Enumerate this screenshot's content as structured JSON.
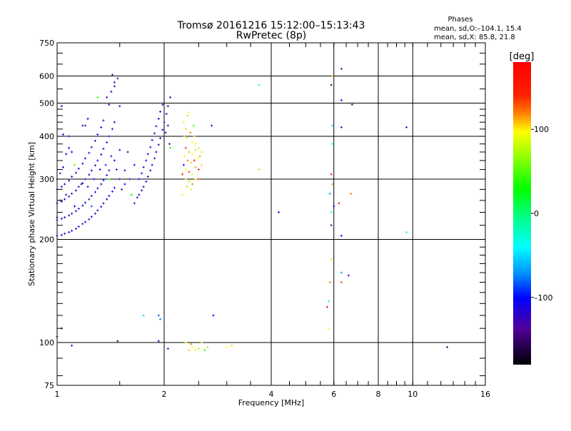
{
  "chart_data": {
    "type": "scatter",
    "title": "Tromsø 20161216 15:12:00–15:13:43",
    "subtitle": "RwPretec (8p)",
    "stats": {
      "title": "Phases",
      "line_o": "mean, sd,O:–104.1, 15.4",
      "line_x": "mean, sd,X:  85.8, 21.8"
    },
    "xlabel": "Frequency [MHz]",
    "ylabel": "Stationary phase Virtual Height [km]",
    "xscale": "log",
    "yscale": "log",
    "xlim": [
      1,
      16
    ],
    "ylim": [
      75,
      750
    ],
    "xticks": [
      1,
      2,
      4,
      6,
      8,
      10,
      16
    ],
    "xtick_labels": [
      "1",
      "2",
      "4",
      "6",
      "8",
      "10",
      "16"
    ],
    "xgrid": [
      2,
      4,
      6,
      8,
      10
    ],
    "yticks": [
      75,
      100,
      200,
      300,
      400,
      500,
      600,
      750
    ],
    "ytick_labels": [
      "75",
      "100",
      "200",
      "300",
      "400",
      "500",
      "600",
      "750"
    ],
    "ygrid": [
      100,
      200,
      300,
      400,
      500,
      600
    ],
    "colorbar": {
      "label": "[deg]",
      "range": [
        -180,
        180
      ],
      "ticks": [
        100,
        0,
        -100
      ],
      "tick_labels": [
        "100",
        "0",
        "–100"
      ]
    },
    "point_format": [
      "frequency_MHz",
      "height_km",
      "phase_deg"
    ],
    "points": [
      [
        1.0,
        205,
        -120
      ],
      [
        1.03,
        206,
        -110
      ],
      [
        1.05,
        208,
        -125
      ],
      [
        1.08,
        210,
        -115
      ],
      [
        1.1,
        212,
        -120
      ],
      [
        1.13,
        215,
        -110
      ],
      [
        1.15,
        218,
        -125
      ],
      [
        1.18,
        222,
        -120
      ],
      [
        1.2,
        225,
        -115
      ],
      [
        1.23,
        229,
        -125
      ],
      [
        1.25,
        233,
        -120
      ],
      [
        1.28,
        238,
        -110
      ],
      [
        1.3,
        243,
        -125
      ],
      [
        1.33,
        249,
        -120
      ],
      [
        1.35,
        255,
        -115
      ],
      [
        1.38,
        262,
        -125
      ],
      [
        1.4,
        268,
        -120
      ],
      [
        1.43,
        276,
        -110
      ],
      [
        1.45,
        283,
        -125
      ],
      [
        1.5,
        300,
        -120
      ],
      [
        1.55,
        318,
        -115
      ],
      [
        1.0,
        228,
        -115
      ],
      [
        1.03,
        230,
        -120
      ],
      [
        1.05,
        232,
        -110
      ],
      [
        1.08,
        235,
        -125
      ],
      [
        1.1,
        238,
        -120
      ],
      [
        1.13,
        242,
        -115
      ],
      [
        1.15,
        246,
        -125
      ],
      [
        1.18,
        251,
        -120
      ],
      [
        1.2,
        256,
        -110
      ],
      [
        1.23,
        262,
        -125
      ],
      [
        1.25,
        268,
        -120
      ],
      [
        1.28,
        275,
        -115
      ],
      [
        1.3,
        282,
        -125
      ],
      [
        1.33,
        290,
        -120
      ],
      [
        1.35,
        298,
        -110
      ],
      [
        1.38,
        308,
        -125
      ],
      [
        1.4,
        318,
        -120
      ],
      [
        1.45,
        340,
        -115
      ],
      [
        1.5,
        365,
        -120
      ],
      [
        1.0,
        255,
        -110
      ],
      [
        1.03,
        258,
        -120
      ],
      [
        1.05,
        262,
        -115
      ],
      [
        1.08,
        267,
        -125
      ],
      [
        1.1,
        272,
        -120
      ],
      [
        1.13,
        278,
        -110
      ],
      [
        1.15,
        285,
        -120
      ],
      [
        1.18,
        292,
        -125
      ],
      [
        1.2,
        300,
        -115
      ],
      [
        1.23,
        309,
        -120
      ],
      [
        1.25,
        318,
        -110
      ],
      [
        1.28,
        329,
        -125
      ],
      [
        1.3,
        340,
        -120
      ],
      [
        1.33,
        354,
        -115
      ],
      [
        1.35,
        368,
        -125
      ],
      [
        1.38,
        384,
        -120
      ],
      [
        1.4,
        400,
        -110
      ],
      [
        1.43,
        420,
        -125
      ],
      [
        1.45,
        440,
        -120
      ],
      [
        1.5,
        490,
        -115
      ],
      [
        1.0,
        280,
        -120
      ],
      [
        1.03,
        285,
        -110
      ],
      [
        1.05,
        290,
        -125
      ],
      [
        1.08,
        297,
        -120
      ],
      [
        1.1,
        305,
        -115
      ],
      [
        1.13,
        313,
        -125
      ],
      [
        1.15,
        322,
        -120
      ],
      [
        1.18,
        333,
        -110
      ],
      [
        1.2,
        345,
        -125
      ],
      [
        1.23,
        358,
        -120
      ],
      [
        1.25,
        372,
        -115
      ],
      [
        1.28,
        388,
        -125
      ],
      [
        1.3,
        405,
        -120
      ],
      [
        1.33,
        425,
        -110
      ],
      [
        1.35,
        445,
        -125
      ],
      [
        1.4,
        495,
        -120
      ],
      [
        1.45,
        560,
        -130
      ],
      [
        1.48,
        590,
        -135
      ],
      [
        1.0,
        300,
        -115
      ],
      [
        1.02,
        312,
        -120
      ],
      [
        1.04,
        325,
        -100
      ],
      [
        1.06,
        355,
        -110
      ],
      [
        1.08,
        370,
        -120
      ],
      [
        1.2,
        430,
        -120
      ],
      [
        1.22,
        450,
        -115
      ],
      [
        1.38,
        520,
        -125
      ],
      [
        1.42,
        540,
        -130
      ],
      [
        1.45,
        575,
        -135
      ],
      [
        1.43,
        605,
        -140
      ],
      [
        1.0,
        232,
        -100
      ],
      [
        1.02,
        260,
        -90
      ],
      [
        1.06,
        270,
        -130
      ],
      [
        1.12,
        250,
        -100
      ],
      [
        1.17,
        290,
        -140
      ],
      [
        1.22,
        285,
        -130
      ],
      [
        1.27,
        300,
        -100
      ],
      [
        1.32,
        320,
        -130
      ],
      [
        1.37,
        330,
        -90
      ],
      [
        1.42,
        350,
        -130
      ],
      [
        1.47,
        320,
        -100
      ],
      [
        1.52,
        280,
        -130
      ],
      [
        1.55,
        290,
        -100
      ],
      [
        1.6,
        300,
        -120
      ],
      [
        1.62,
        270,
        30
      ],
      [
        1.58,
        360,
        -110
      ],
      [
        1.65,
        330,
        -120
      ],
      [
        1.65,
        255,
        -120
      ],
      [
        1.68,
        265,
        -115
      ],
      [
        1.7,
        270,
        -125
      ],
      [
        1.73,
        278,
        -120
      ],
      [
        1.75,
        285,
        -110
      ],
      [
        1.78,
        295,
        -125
      ],
      [
        1.8,
        305,
        -120
      ],
      [
        1.83,
        318,
        -115
      ],
      [
        1.85,
        330,
        -125
      ],
      [
        1.88,
        345,
        -120
      ],
      [
        1.9,
        360,
        -110
      ],
      [
        1.93,
        378,
        -125
      ],
      [
        1.95,
        395,
        -120
      ],
      [
        1.98,
        418,
        -115
      ],
      [
        2.0,
        440,
        -125
      ],
      [
        2.03,
        465,
        -120
      ],
      [
        2.05,
        490,
        -130
      ],
      [
        2.08,
        520,
        -125
      ],
      [
        1.7,
        300,
        -120
      ],
      [
        1.73,
        312,
        -110
      ],
      [
        1.75,
        325,
        -125
      ],
      [
        1.78,
        340,
        -120
      ],
      [
        1.8,
        355,
        -100
      ],
      [
        1.83,
        372,
        -125
      ],
      [
        1.85,
        390,
        -120
      ],
      [
        1.88,
        408,
        -115
      ],
      [
        1.9,
        428,
        -125
      ],
      [
        1.93,
        450,
        -120
      ],
      [
        1.95,
        472,
        -110
      ],
      [
        1.98,
        495,
        -130
      ],
      [
        2.02,
        410,
        -120
      ],
      [
        2.05,
        430,
        -130
      ],
      [
        2.07,
        380,
        -130
      ],
      [
        2.08,
        370,
        40
      ],
      [
        1.03,
        490,
        -110
      ],
      [
        1.08,
        400,
        -100
      ],
      [
        1.1,
        360,
        -100
      ],
      [
        1.18,
        430,
        -140
      ],
      [
        1.25,
        250,
        -80
      ],
      [
        1.3,
        520,
        40
      ],
      [
        1.4,
        300,
        40
      ],
      [
        1.04,
        405,
        -100
      ],
      [
        1.12,
        330,
        60
      ],
      [
        2.27,
        440,
        90
      ],
      [
        2.3,
        420,
        110
      ],
      [
        2.33,
        460,
        70
      ],
      [
        2.35,
        470,
        100
      ],
      [
        2.28,
        400,
        120
      ],
      [
        2.32,
        395,
        80
      ],
      [
        2.37,
        410,
        130
      ],
      [
        2.4,
        385,
        100
      ],
      [
        2.43,
        400,
        110
      ],
      [
        2.45,
        380,
        90
      ],
      [
        2.3,
        370,
        140
      ],
      [
        2.35,
        360,
        120
      ],
      [
        2.4,
        355,
        100
      ],
      [
        2.45,
        365,
        80
      ],
      [
        2.5,
        370,
        110
      ],
      [
        2.28,
        350,
        90
      ],
      [
        2.33,
        340,
        130
      ],
      [
        2.38,
        335,
        110
      ],
      [
        2.43,
        340,
        150
      ],
      [
        2.48,
        345,
        100
      ],
      [
        2.52,
        350,
        120
      ],
      [
        2.3,
        320,
        100
      ],
      [
        2.35,
        315,
        140
      ],
      [
        2.4,
        310,
        90
      ],
      [
        2.45,
        325,
        120
      ],
      [
        2.5,
        320,
        150
      ],
      [
        2.55,
        330,
        110
      ],
      [
        2.3,
        300,
        110
      ],
      [
        2.35,
        295,
        80
      ],
      [
        2.4,
        290,
        130
      ],
      [
        2.45,
        300,
        100
      ],
      [
        2.32,
        285,
        60
      ],
      [
        2.38,
        280,
        90
      ],
      [
        2.25,
        310,
        150
      ],
      [
        2.25,
        270,
        95
      ],
      [
        2.42,
        430,
        50
      ],
      [
        2.55,
        360,
        90
      ],
      [
        2.5,
        300,
        140
      ],
      [
        2.27,
        330,
        -100
      ],
      [
        2.72,
        430,
        -100
      ],
      [
        5.95,
        600,
        120
      ],
      [
        5.9,
        565,
        -160
      ],
      [
        6.3,
        630,
        -140
      ],
      [
        6.3,
        510,
        -110
      ],
      [
        6.75,
        495,
        -150
      ],
      [
        5.95,
        430,
        -50
      ],
      [
        6.3,
        425,
        -120
      ],
      [
        9.6,
        425,
        -100
      ],
      [
        3.7,
        565,
        -40
      ],
      [
        3.7,
        320,
        110
      ],
      [
        5.95,
        380,
        -40
      ],
      [
        5.9,
        310,
        160
      ],
      [
        5.95,
        290,
        130
      ],
      [
        5.85,
        272,
        -60
      ],
      [
        6.7,
        272,
        130
      ],
      [
        6.2,
        255,
        160
      ],
      [
        6.0,
        250,
        -110
      ],
      [
        5.9,
        240,
        -40
      ],
      [
        5.9,
        220,
        -140
      ],
      [
        4.2,
        240,
        -110
      ],
      [
        6.3,
        205,
        -110
      ],
      [
        9.6,
        210,
        -20
      ],
      [
        5.9,
        175,
        110
      ],
      [
        6.3,
        160,
        -60
      ],
      [
        6.6,
        157,
        -120
      ],
      [
        5.85,
        150,
        130
      ],
      [
        6.3,
        150,
        140
      ],
      [
        5.8,
        132,
        -40
      ],
      [
        5.75,
        127,
        170
      ],
      [
        5.8,
        110,
        100
      ],
      [
        1.0,
        104,
        -140
      ],
      [
        1.03,
        110,
        -100
      ],
      [
        1.1,
        98,
        -120
      ],
      [
        1.48,
        101,
        -150
      ],
      [
        1.75,
        120,
        -50
      ],
      [
        1.93,
        120,
        -80
      ],
      [
        1.95,
        117,
        -70
      ],
      [
        1.93,
        101,
        -120
      ],
      [
        2.05,
        96,
        -120
      ],
      [
        2.3,
        100,
        90
      ],
      [
        2.4,
        97,
        100
      ],
      [
        2.55,
        100,
        110
      ],
      [
        2.65,
        97,
        70
      ],
      [
        2.75,
        120,
        -110
      ],
      [
        3.0,
        97,
        100
      ],
      [
        3.1,
        98,
        110
      ],
      [
        12.5,
        97,
        -150
      ],
      [
        2.35,
        95,
        110
      ],
      [
        2.45,
        95,
        90
      ],
      [
        2.6,
        95,
        40
      ],
      [
        2.38,
        99,
        130
      ],
      [
        2.5,
        96,
        80
      ]
    ]
  }
}
